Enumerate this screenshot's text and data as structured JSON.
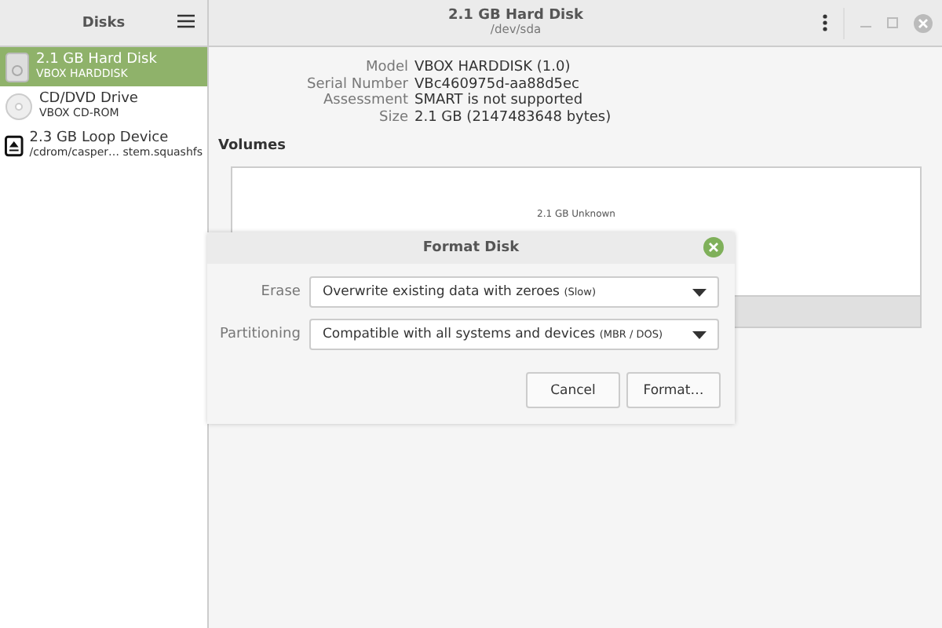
{
  "sidebar": {
    "title": "Disks",
    "items": [
      {
        "kind": "harddisk",
        "name": "2.1 GB Hard Disk",
        "detail": "VBOX HARDDISK",
        "selected": true
      },
      {
        "kind": "optical",
        "name": "CD/DVD Drive",
        "detail": "VBOX CD-ROM",
        "selected": false
      },
      {
        "kind": "loop",
        "name": "2.3 GB Loop Device",
        "detail": "/cdrom/casper… stem.squashfs",
        "selected": false
      }
    ]
  },
  "header": {
    "title": "2.1 GB Hard Disk",
    "subtitle": "/dev/sda"
  },
  "properties": [
    {
      "label": "Model",
      "value": "VBOX HARDDISK (1.0)"
    },
    {
      "label": "Serial Number",
      "value": "VBc460975d-aa88d5ec"
    },
    {
      "label": "Assessment",
      "value": "SMART is not supported"
    },
    {
      "label": "Size",
      "value": "2.1 GB (2147483648 bytes)"
    }
  ],
  "volumes": {
    "heading": "Volumes",
    "partition_label": "2.1 GB Unknown"
  },
  "dialog": {
    "title": "Format Disk",
    "fields": [
      {
        "label": "Erase",
        "value": "Overwrite existing data with zeroes",
        "note": "(Slow)"
      },
      {
        "label": "Partitioning",
        "value": "Compatible with all systems and devices",
        "note": "(MBR / DOS)"
      }
    ],
    "buttons": [
      "Cancel",
      "Format…"
    ]
  }
}
